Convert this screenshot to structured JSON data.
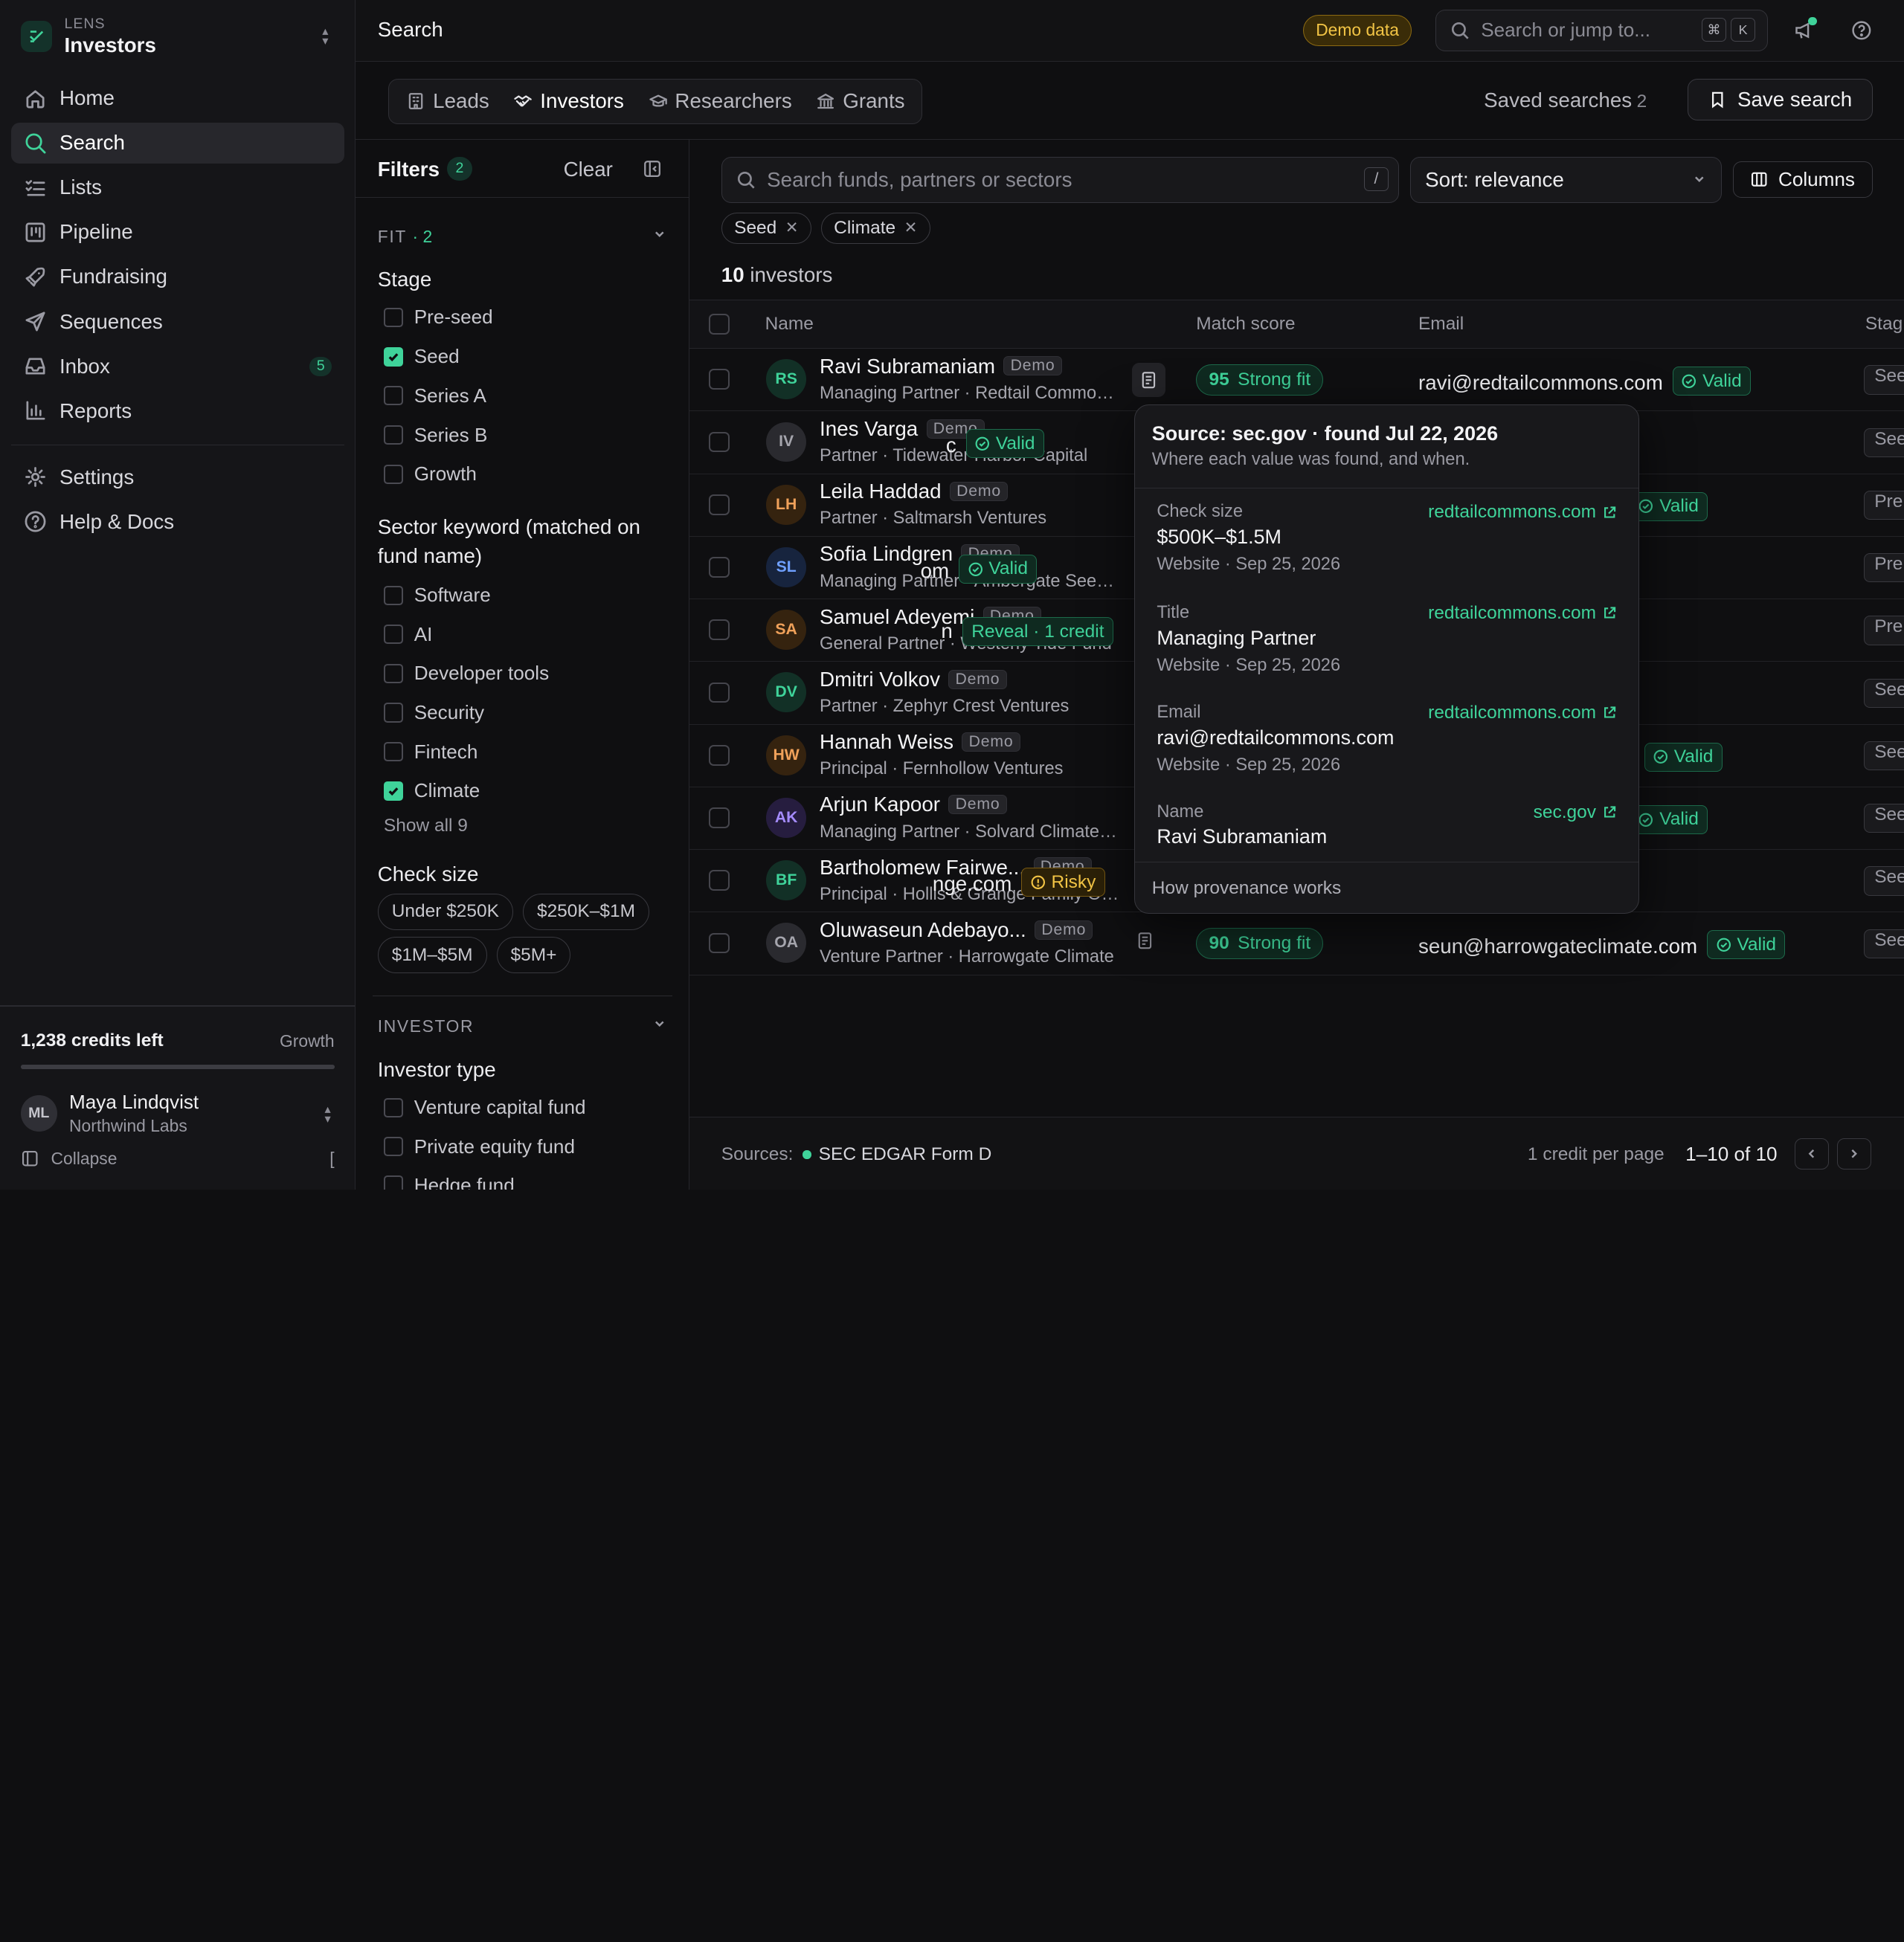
{
  "brand": {
    "small": "LENS",
    "name": "Investors"
  },
  "nav": [
    {
      "label": "Home",
      "icon": "home-icon"
    },
    {
      "label": "Search",
      "icon": "search-icon",
      "active": true
    },
    {
      "label": "Lists",
      "icon": "list-icon"
    },
    {
      "label": "Pipeline",
      "icon": "kanban-icon"
    },
    {
      "label": "Fundraising",
      "icon": "rocket-icon"
    },
    {
      "label": "Sequences",
      "icon": "send-icon"
    },
    {
      "label": "Inbox",
      "icon": "inbox-icon",
      "badge": "5"
    },
    {
      "label": "Reports",
      "icon": "bar-chart-icon"
    }
  ],
  "nav_secondary": [
    {
      "label": "Settings",
      "icon": "gear-icon"
    },
    {
      "label": "Help & Docs",
      "icon": "help-icon"
    }
  ],
  "credits": {
    "text": "1,238 credits left",
    "plan": "Growth",
    "used_fraction": 1.0
  },
  "user": {
    "initials": "ML",
    "name": "Maya Lindqvist",
    "org": "Northwind Labs"
  },
  "collapse": {
    "label": "Collapse",
    "shortcut": "["
  },
  "topbar": {
    "title": "Search",
    "demo_badge": "Demo data",
    "jump_placeholder": "Search or jump to...",
    "kbd1": "⌘",
    "kbd2": "K"
  },
  "tabs": [
    {
      "label": "Leads",
      "icon": "building-icon"
    },
    {
      "label": "Investors",
      "icon": "handshake-icon",
      "active": true
    },
    {
      "label": "Researchers",
      "icon": "graduation-cap-icon"
    },
    {
      "label": "Grants",
      "icon": "landmark-icon"
    }
  ],
  "saved_searches": {
    "label": "Saved searches",
    "count": "2"
  },
  "save_search": "Save search",
  "filters": {
    "title": "Filters",
    "count": "2",
    "clear": "Clear",
    "fit": {
      "label": "FIT",
      "count": "· 2"
    },
    "stage": {
      "label": "Stage",
      "options": [
        {
          "label": "Pre-seed",
          "checked": false
        },
        {
          "label": "Seed",
          "checked": true
        },
        {
          "label": "Series A",
          "checked": false
        },
        {
          "label": "Series B",
          "checked": false
        },
        {
          "label": "Growth",
          "checked": false
        }
      ]
    },
    "sector": {
      "label": "Sector keyword (matched on fund name)",
      "options": [
        {
          "label": "Software",
          "checked": false
        },
        {
          "label": "AI",
          "checked": false
        },
        {
          "label": "Developer tools",
          "checked": false
        },
        {
          "label": "Security",
          "checked": false
        },
        {
          "label": "Fintech",
          "checked": false
        },
        {
          "label": "Climate",
          "checked": true
        }
      ],
      "show_all": "Show all 9"
    },
    "check_size": {
      "label": "Check size",
      "options": [
        "Under $250K",
        "$250K–$1M",
        "$1M–$5M",
        "$5M+"
      ]
    },
    "investor": {
      "label": "INVESTOR"
    },
    "investor_type": {
      "label": "Investor type",
      "options": [
        {
          "label": "Venture capital fund",
          "checked": false
        },
        {
          "label": "Private equity fund",
          "checked": false
        },
        {
          "label": "Hedge fund",
          "checked": false
        }
      ]
    }
  },
  "main": {
    "search_placeholder": "Search funds, partners or sectors",
    "search_kbd": "/",
    "sort": "Sort: relevance",
    "columns": "Columns",
    "active_chips": [
      "Seed",
      "Climate"
    ],
    "count_num": "10",
    "count_label": "investors",
    "headers": {
      "name": "Name",
      "score": "Match score",
      "email": "Email",
      "stage": "Stag"
    }
  },
  "rows": [
    {
      "initials": "RS",
      "color": "#3fd39a",
      "bg": "#123026",
      "name": "Ravi Subramaniam",
      "demo": "Demo",
      "sub": "Managing Partner · Redtail Commons Ventures",
      "score": "95",
      "fit": "Strong fit",
      "email": "ravi@redtailcommons.com",
      "status": "Valid",
      "status_type": "valid",
      "stage": "See"
    },
    {
      "initials": "IV",
      "color": "#a5a5ad",
      "bg": "#2a2a2f",
      "name": "Ines Varga",
      "demo": "Demo",
      "sub": "Partner · Tidewater Harbor Capital",
      "score": "",
      "fit": "",
      "email": "c",
      "status": "Valid",
      "status_type": "valid",
      "stage": "See"
    },
    {
      "initials": "LH",
      "color": "#f0a15a",
      "bg": "#35230f",
      "name": "Leila Haddad",
      "demo": "Demo",
      "sub": "Partner · Saltmarsh Ventures",
      "score": "",
      "fit": "",
      "email": "",
      "status": "Valid",
      "status_type": "valid",
      "stage": "Pre"
    },
    {
      "initials": "SL",
      "color": "#6fa0ff",
      "bg": "#17243e",
      "name": "Sofia Lindgren",
      "demo": "Demo",
      "sub": "Managing Partner · Ambergate Seed Fund",
      "score": "",
      "fit": "",
      "email": "om",
      "status": "Valid",
      "status_type": "valid",
      "stage": "Pre"
    },
    {
      "initials": "SA",
      "color": "#f0a15a",
      "bg": "#35230f",
      "name": "Samuel Adeyemi",
      "demo": "Demo",
      "sub": "General Partner · Westerly Tide Fund",
      "score": "",
      "fit": "",
      "email": "n",
      "status": "Reveal · 1 credit",
      "status_type": "reveal",
      "stage": "Pre"
    },
    {
      "initials": "DV",
      "color": "#3fd39a",
      "bg": "#123026",
      "name": "Dmitri Volkov",
      "demo": "Demo",
      "sub": "Partner · Zephyr Crest Ventures",
      "score": "",
      "fit": "",
      "email": "",
      "status": "",
      "status_type": "",
      "stage": "See"
    },
    {
      "initials": "HW",
      "color": "#f0a15a",
      "bg": "#35230f",
      "name": "Hannah Weiss",
      "demo": "Demo",
      "sub": "Principal · Fernhollow Ventures",
      "score": "",
      "fit": "",
      "email": "",
      "status": "Valid",
      "status_type": "valid",
      "stage": "See"
    },
    {
      "initials": "AK",
      "color": "#a58cff",
      "bg": "#261d3f",
      "name": "Arjun Kapoor",
      "demo": "Demo",
      "sub": "Managing Partner · Solvard Climate Fund",
      "score": "",
      "fit": "",
      "email": "",
      "status": "Valid",
      "status_type": "valid",
      "stage": "See"
    },
    {
      "initials": "BF",
      "color": "#3fd39a",
      "bg": "#123026",
      "name": "Bartholomew Fairwe...",
      "demo": "Demo",
      "sub": "Principal · Hollis & Grange Family Office",
      "score": "",
      "fit": "",
      "email": "nge.com",
      "status": "Risky",
      "status_type": "risky",
      "stage": "See"
    },
    {
      "initials": "OA",
      "color": "#a5a5ad",
      "bg": "#2a2a2f",
      "name": "Oluwaseun Adebayo...",
      "demo": "Demo",
      "sub": "Venture Partner · Harrowgate Climate",
      "score": "90",
      "fit": "Strong fit",
      "email": "seun@harrowgateclimate.com",
      "status": "Valid",
      "status_type": "valid",
      "stage": "See"
    }
  ],
  "footer": {
    "sources_label": "Sources:",
    "source": "SEC EDGAR Form D",
    "per_page": "1 credit per page",
    "range": "1–10 of 10"
  },
  "popover": {
    "title": "Source: sec.gov · found Jul 22, 2026",
    "subtitle": "Where each value was found, and when.",
    "entries": [
      {
        "label": "Check size",
        "value": "$500K–$1.5M",
        "meta": "Website · Sep 25, 2026",
        "link": "redtailcommons.com"
      },
      {
        "label": "Title",
        "value": "Managing Partner",
        "meta": "Website · Sep 25, 2026",
        "link": "redtailcommons.com"
      },
      {
        "label": "Email",
        "value": "ravi@redtailcommons.com",
        "meta": "Website · Sep 25, 2026",
        "link": "redtailcommons.com"
      },
      {
        "label": "Name",
        "value": "Ravi Subramaniam",
        "meta": "",
        "link": "sec.gov"
      }
    ],
    "footer": "How provenance works"
  }
}
